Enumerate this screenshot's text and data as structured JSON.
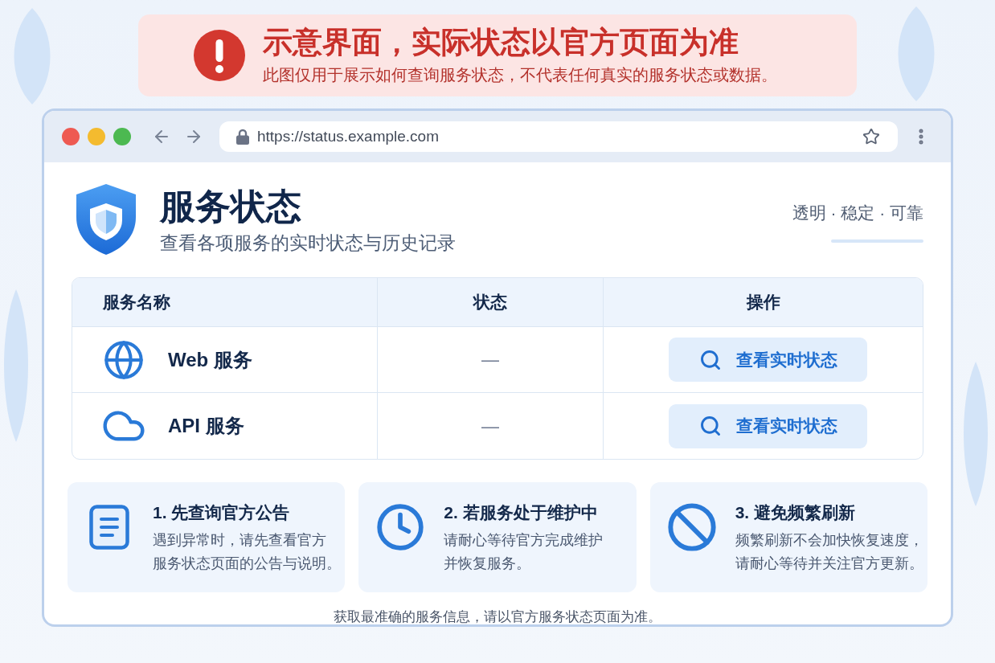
{
  "notice": {
    "title": "示意界面，实际状态以官方页面为准",
    "subtitle": "此图仅用于展示如何查询服务状态，不代表任何真实的服务状态或数据。"
  },
  "browser": {
    "url": "https://status.example.com"
  },
  "header": {
    "title": "服务状态",
    "subtitle": "查看各项服务的实时状态与历史记录",
    "tagline": "透明 · 稳定 · 可靠"
  },
  "table": {
    "columns": [
      "服务名称",
      "状态",
      "操作"
    ],
    "rows": [
      {
        "kind": "web",
        "name": "Web 服务",
        "status": "—",
        "action": "查看实时状态"
      },
      {
        "kind": "api",
        "name": "API 服务",
        "status": "—",
        "action": "查看实时状态"
      }
    ]
  },
  "tips": [
    {
      "kind": "document",
      "title": "1. 先查询官方公告",
      "lines": [
        "遇到异常时，请先查看官方",
        "服务状态页面的公告与说明。"
      ]
    },
    {
      "kind": "clock",
      "title": "2. 若服务处于维护中",
      "lines": [
        "请耐心等待官方完成维护",
        "并恢复服务。"
      ]
    },
    {
      "kind": "ban",
      "title": "3. 避免频繁刷新",
      "lines": [
        "频繁刷新不会加快恢复速度，",
        "请耐心等待并关注官方更新。"
      ]
    }
  ],
  "footer": "获取最准确的服务信息，请以官方服务状态页面为准。"
}
